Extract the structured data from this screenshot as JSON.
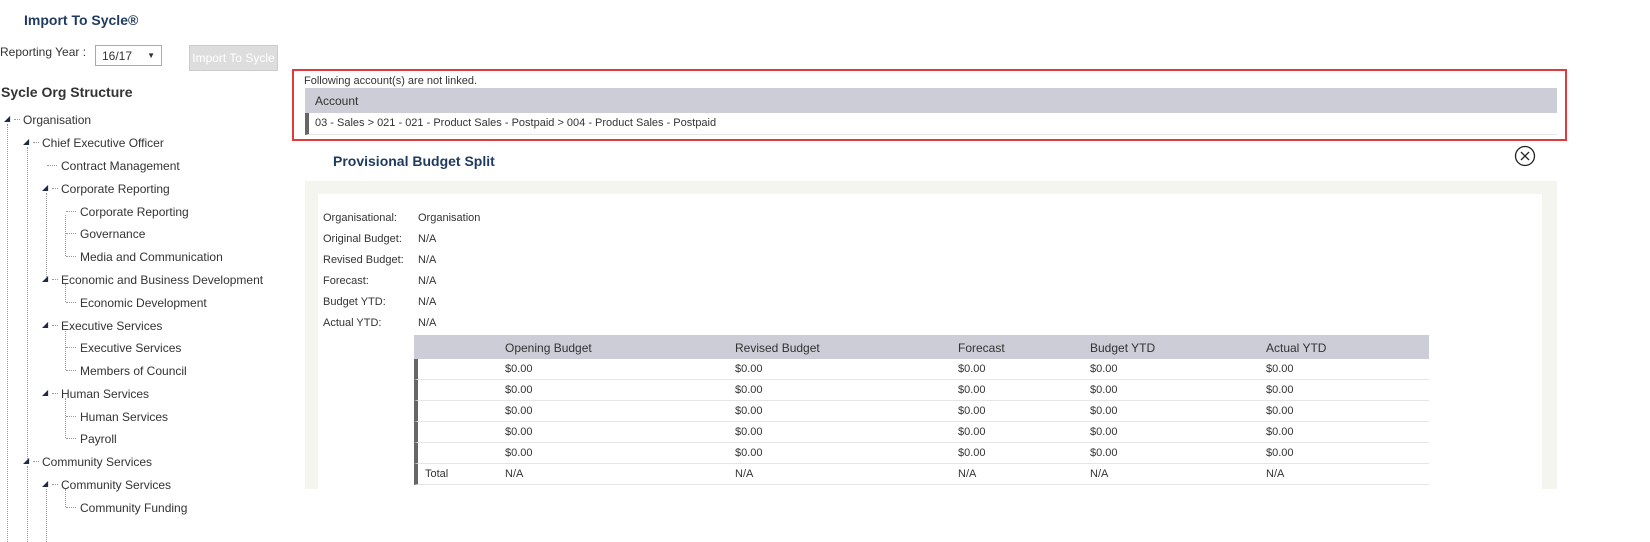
{
  "left_panel": {
    "import_title": "Import To Sycle®",
    "reporting_year_label": "Reporting Year :",
    "reporting_year_value": "16/17",
    "import_button": "Import To Sycle",
    "org_structure_title": "Sycle Org Structure",
    "tree": [
      "Organisation",
      "Chief Executive Officer",
      "Contract Management",
      "Corporate Reporting",
      "Corporate Reporting",
      "Governance",
      "Media and Communication",
      "Economic and Business Development",
      "Economic Development",
      "Executive Services",
      "Executive Services",
      "Members of Council",
      "Human Services",
      "Human Services",
      "Payroll",
      "Community Services",
      "Community Services",
      "Community Funding"
    ]
  },
  "warning": {
    "text": "Following account(s) are not linked.",
    "column_header": "Account",
    "account_row": "03 - Sales > 021 - 021 - Product Sales - Postpaid > 004 - Product Sales - Postpaid"
  },
  "budget_split": {
    "title": "Provisional Budget Split",
    "info": [
      {
        "label": "Organisational:",
        "value": "Organisation"
      },
      {
        "label": "Original Budget:",
        "value": "N/A"
      },
      {
        "label": "Revised Budget:",
        "value": "N/A"
      },
      {
        "label": "Forecast:",
        "value": "N/A"
      },
      {
        "label": "Budget YTD:",
        "value": "N/A"
      },
      {
        "label": "Actual YTD:",
        "value": "N/A"
      }
    ],
    "columns": [
      "",
      "Opening Budget",
      "Revised Budget",
      "Forecast",
      "Budget YTD",
      "Actual YTD"
    ],
    "rows": [
      [
        "",
        "$0.00",
        "$0.00",
        "$0.00",
        "$0.00",
        "$0.00"
      ],
      [
        "",
        "$0.00",
        "$0.00",
        "$0.00",
        "$0.00",
        "$0.00"
      ],
      [
        "",
        "$0.00",
        "$0.00",
        "$0.00",
        "$0.00",
        "$0.00"
      ],
      [
        "",
        "$0.00",
        "$0.00",
        "$0.00",
        "$0.00",
        "$0.00"
      ],
      [
        "",
        "$0.00",
        "$0.00",
        "$0.00",
        "$0.00",
        "$0.00"
      ],
      [
        "Total",
        "N/A",
        "N/A",
        "N/A",
        "N/A",
        "N/A"
      ]
    ]
  }
}
